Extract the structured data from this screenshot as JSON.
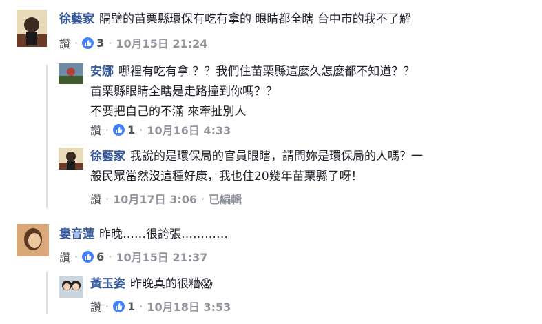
{
  "comments": [
    {
      "author": "徐藝家",
      "text": "隔壁的苗栗縣環保有吃有拿的 眼睛都全瞎 台中市的我不了解",
      "like_label": "讚",
      "reactions": "3",
      "time": "10月15日 21:24"
    },
    {
      "author": "安娜",
      "text": "哪裡有吃有拿 ？？我們住苗栗縣這麼久怎麼都不知道？？",
      "text_line2": "苗栗縣眼睛全瞎是走路撞到你嗎？？",
      "text_line3": "不要把自己的不滿 來牽扯別人",
      "like_label": "讚",
      "reactions": "1",
      "time": "10月16日 4:33"
    },
    {
      "author": "徐藝家",
      "text": "我說的是環保局的官員眼瞎，請問妳是環保局的人嗎？一",
      "text_line2": "般民眾當然沒這種好康，我也住20幾年苗栗縣了呀！",
      "like_label": "讚",
      "time": "10月17日 3:06",
      "edited": "已編輯"
    },
    {
      "author": "婁音蓮",
      "text": "昨晚……很誇張…………",
      "like_label": "讚",
      "reactions": "6",
      "time": "10月15日 21:37"
    },
    {
      "author": "黃玉姿",
      "text": "昨晚真的很糟",
      "emoji": "😱",
      "like_label": "讚",
      "reactions": "1",
      "time": "10月18日 3:53"
    }
  ],
  "colors": {
    "author": "#365899",
    "like_badge": "#4080ff",
    "meta": "#90949c"
  },
  "separator": "·"
}
